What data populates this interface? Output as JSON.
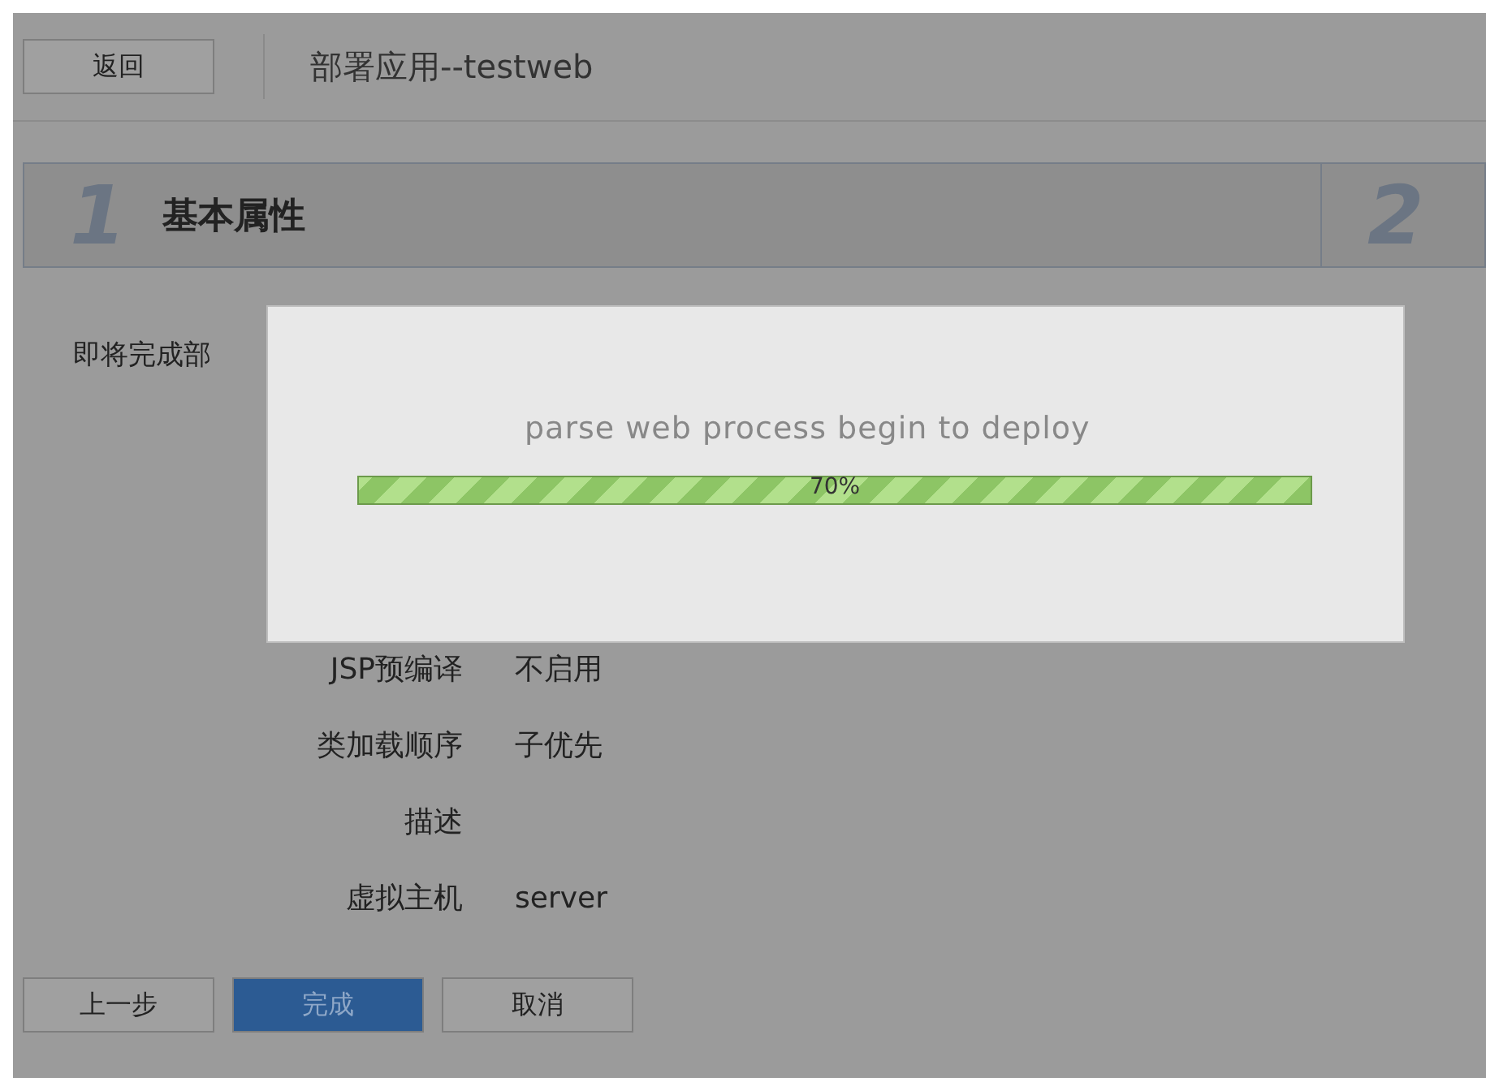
{
  "header": {
    "back_button": "返回",
    "title": "部署应用--testweb"
  },
  "steps": [
    {
      "number": "1",
      "label": "基本属性"
    },
    {
      "number": "2"
    }
  ],
  "intro": "即将完成部",
  "fields": [
    {
      "label": "JSP预编译",
      "value": "不启用"
    },
    {
      "label": "类加载顺序",
      "value": "子优先"
    },
    {
      "label": "描述"
    },
    {
      "label": "虚拟主机",
      "value": "server"
    }
  ],
  "buttons": [
    {
      "label": "上一步",
      "kind": "normal"
    },
    {
      "label": "完成",
      "kind": "primary"
    },
    {
      "label": "取消",
      "kind": "normal"
    }
  ],
  "progress_dialog": {
    "message": "parse web process begin to deploy",
    "level": 1,
    "percent": "70%"
  }
}
